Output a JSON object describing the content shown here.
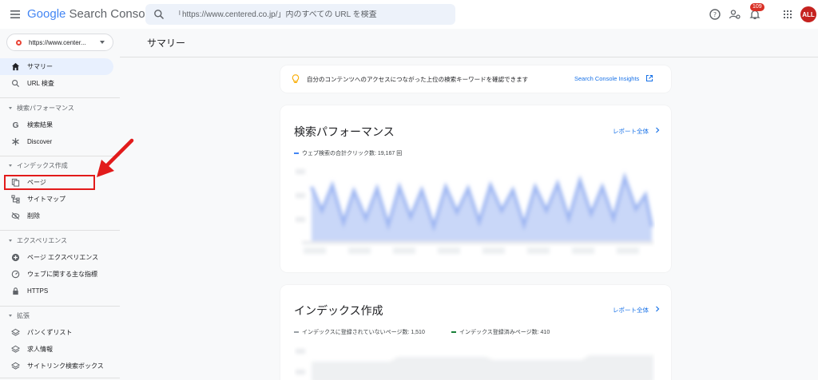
{
  "header": {
    "logo_google": "Google",
    "logo_product": "Search Console",
    "search_placeholder": "「https://www.centered.co.jp/」内のすべての URL を検査",
    "notification_count": "109",
    "avatar_initials": "ALL"
  },
  "sidebar": {
    "property": "https://www.center...",
    "items_top": [
      {
        "label": "サマリー",
        "icon": "home-icon",
        "active": true
      },
      {
        "label": "URL 検査",
        "icon": "search-icon"
      }
    ],
    "sections": [
      {
        "title": "検索パフォーマンス",
        "items": [
          {
            "label": "検索結果",
            "icon": "google-g-icon"
          },
          {
            "label": "Discover",
            "icon": "asterisk-icon"
          }
        ]
      },
      {
        "title": "インデックス作成",
        "items": [
          {
            "label": "ページ",
            "icon": "pages-icon"
          },
          {
            "label": "サイトマップ",
            "icon": "sitemap-icon"
          },
          {
            "label": "削除",
            "icon": "removal-icon"
          }
        ]
      },
      {
        "title": "エクスペリエンス",
        "items": [
          {
            "label": "ページ エクスペリエンス",
            "icon": "plus-circle-icon"
          },
          {
            "label": "ウェブに関する主な指標",
            "icon": "gauge-icon"
          },
          {
            "label": "HTTPS",
            "icon": "lock-icon"
          }
        ]
      },
      {
        "title": "拡張",
        "items": [
          {
            "label": "パンくずリスト",
            "icon": "layers-icon"
          },
          {
            "label": "求人情報",
            "icon": "layers-icon"
          },
          {
            "label": "サイトリンク検索ボックス",
            "icon": "layers-icon"
          }
        ]
      }
    ]
  },
  "main": {
    "page_title": "サマリー",
    "insight": {
      "text": "自分のコンテンツへのアクセスにつながった上位の検索キーワードを確認できます",
      "link": "Search Console Insights"
    },
    "performance": {
      "title": "検索パフォーマンス",
      "report_link": "レポート全体",
      "legend": "ウェブ検索の合計クリック数: 19,167 回"
    },
    "indexing": {
      "title": "インデックス作成",
      "report_link": "レポート全体",
      "legend_not_indexed": "インデックスに登録されていないページ数: 1,510",
      "legend_indexed": "インデックス登録済みページ数: 410"
    }
  },
  "colors": {
    "accent": "#1a73e8",
    "highlight": "#e21b1b",
    "legend_clicks": "#4285f4",
    "legend_not_indexed": "#9aa0a6",
    "legend_indexed": "#188038"
  }
}
